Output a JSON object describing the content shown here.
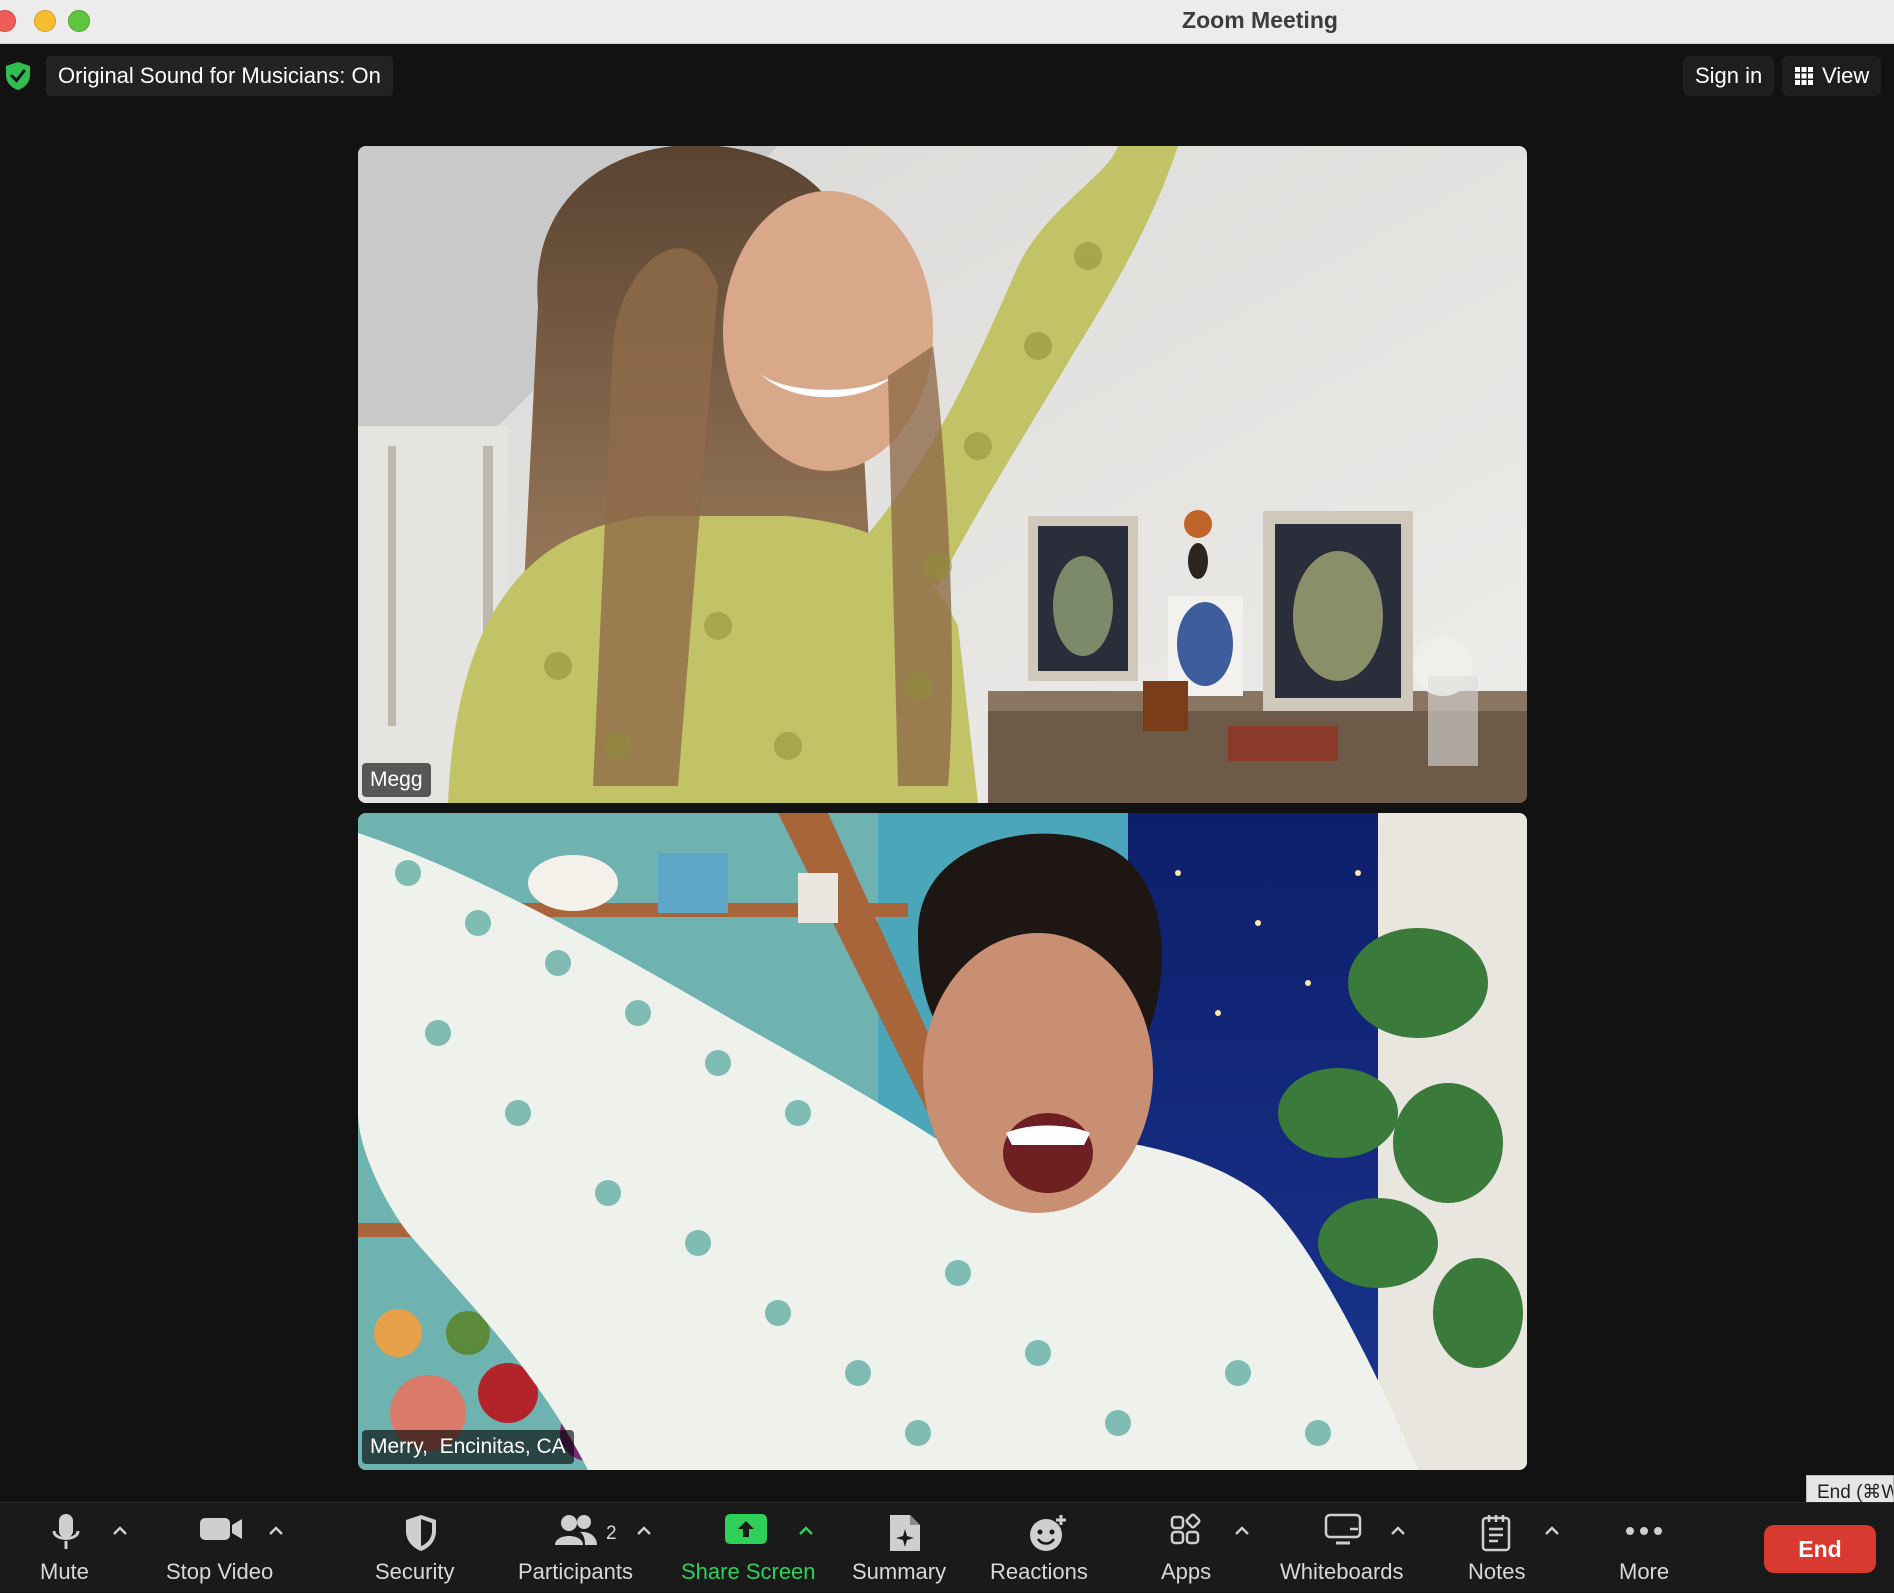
{
  "window": {
    "title": "Zoom Meeting"
  },
  "banner": {
    "sound_status": "Original Sound for Musicians: On"
  },
  "header": {
    "sign_in": "Sign in",
    "view": "View"
  },
  "participants": [
    {
      "name": "Megg"
    },
    {
      "name": "Merry,  Encinitas, CA"
    }
  ],
  "tooltip": {
    "end_shortcut": "End (⌘W"
  },
  "toolbar": {
    "mute": "Mute",
    "stop_video": "Stop Video",
    "security": "Security",
    "participants": "Participants",
    "participant_count": "2",
    "share_screen": "Share Screen",
    "summary": "Summary",
    "reactions": "Reactions",
    "apps": "Apps",
    "whiteboards": "Whiteboards",
    "notes": "Notes",
    "more": "More",
    "end": "End"
  },
  "colors": {
    "share_green": "#2fd05a",
    "end_red": "#d83a2f",
    "shield_green": "#2fbe4f"
  }
}
